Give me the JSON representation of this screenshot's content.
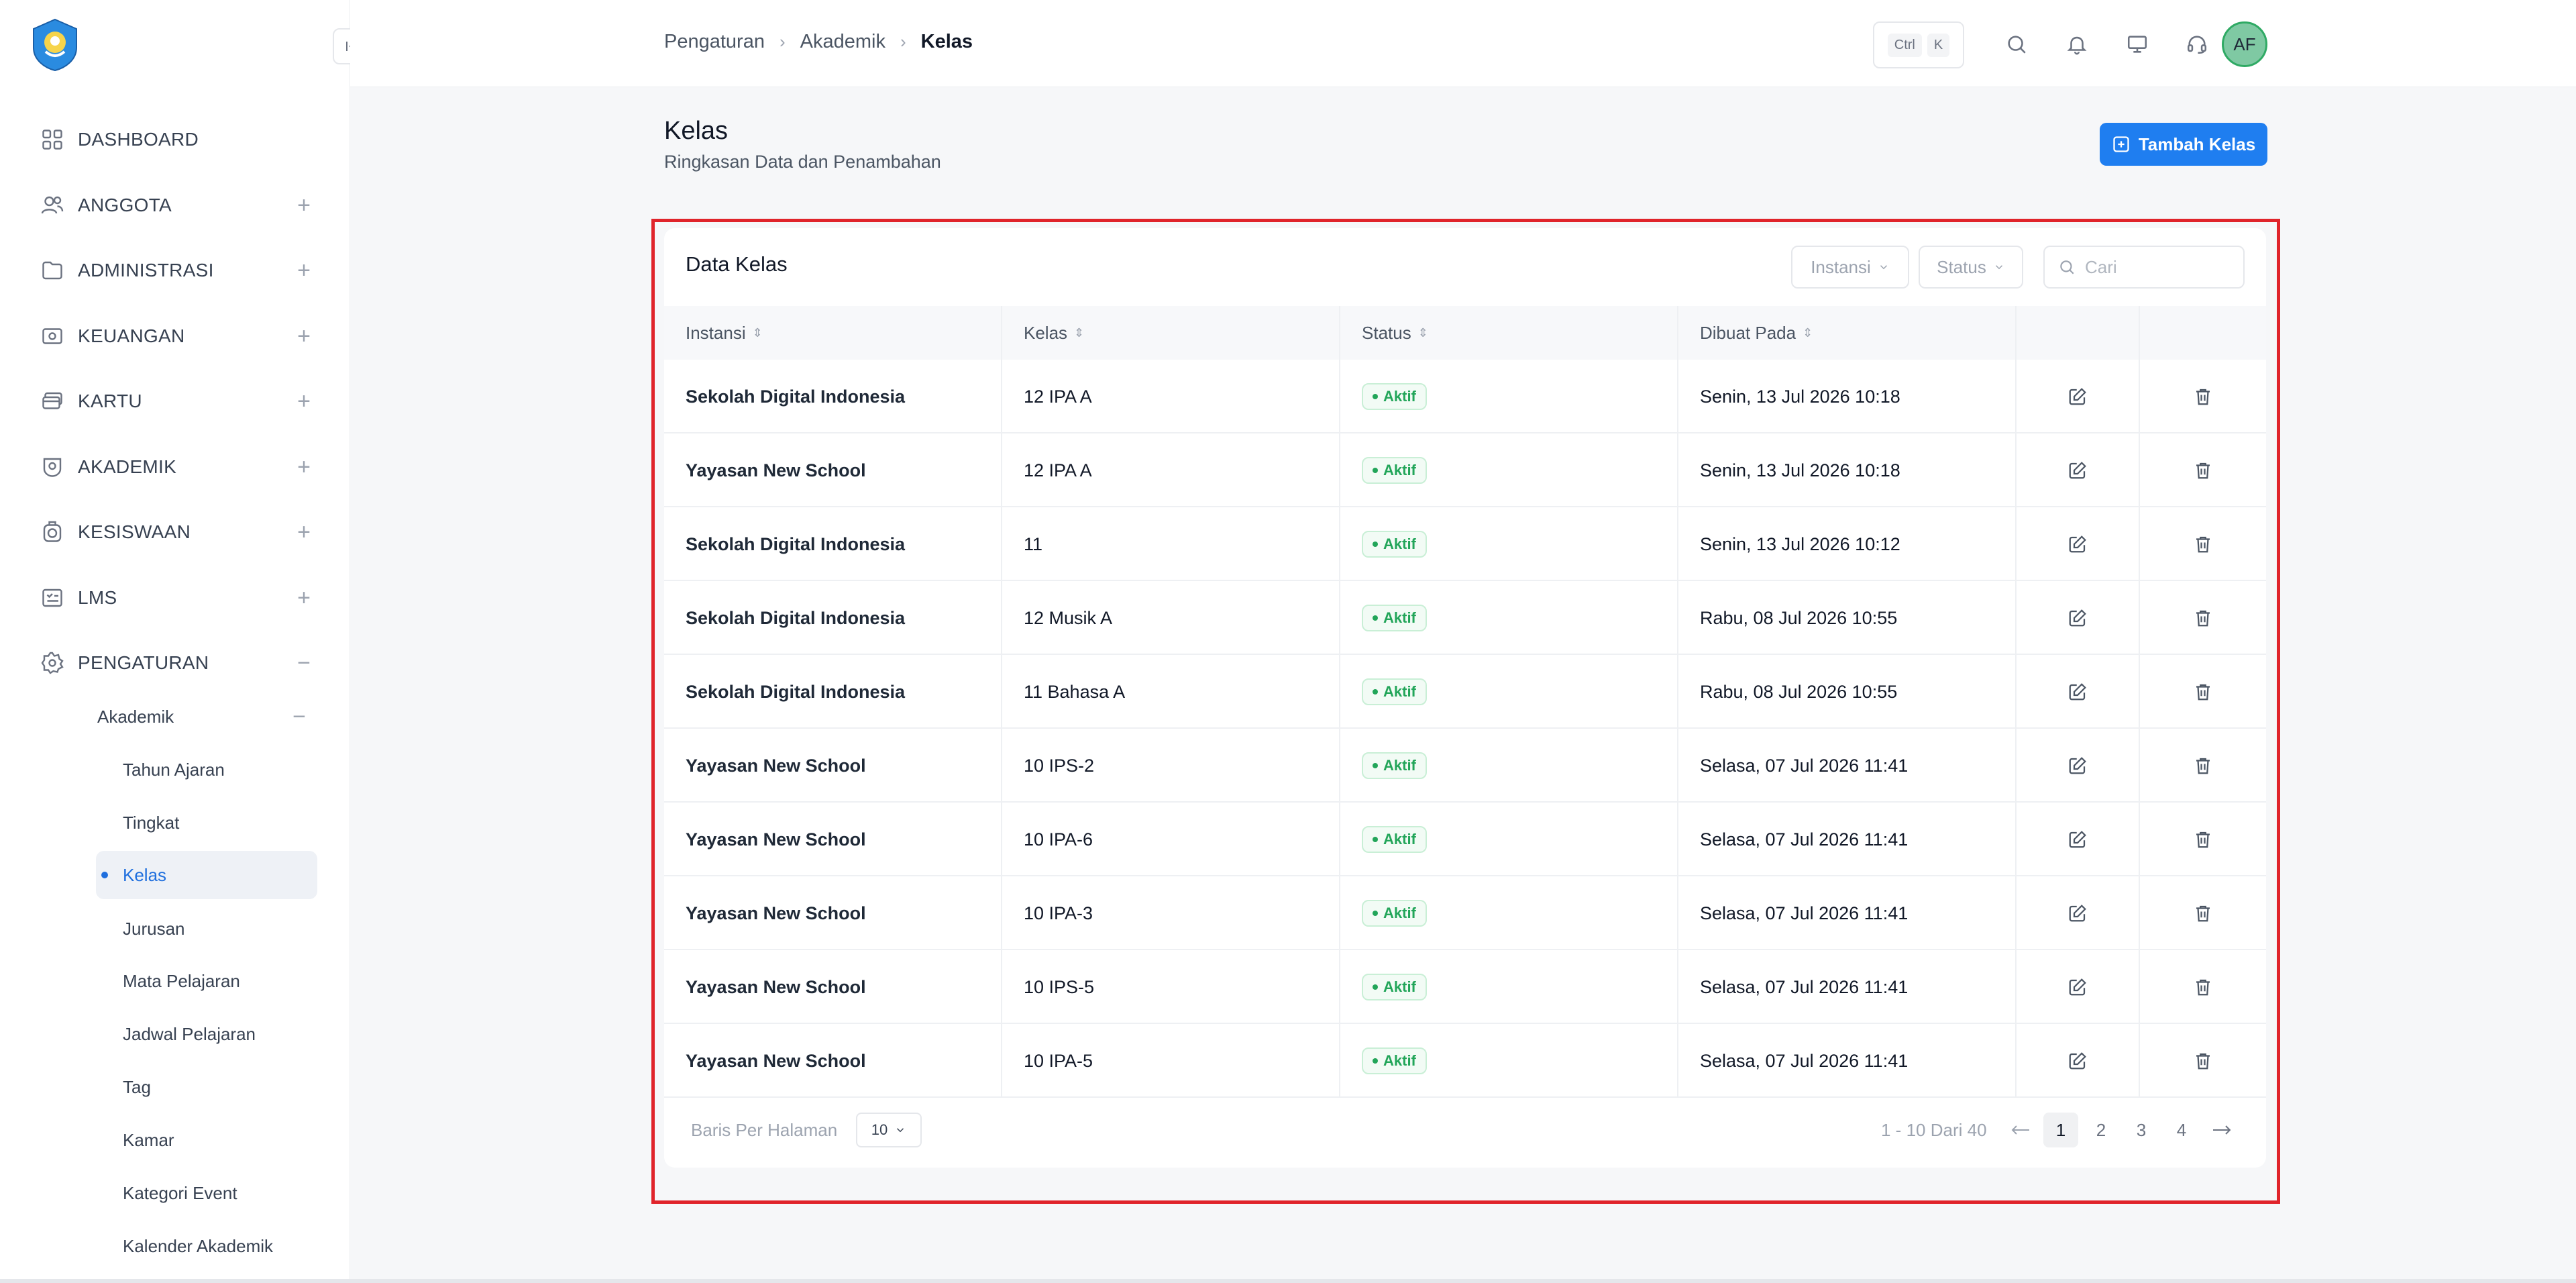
{
  "sidebar": {
    "items": [
      {
        "label": "DASHBOARD",
        "icon": "dashboard-icon",
        "expand": ""
      },
      {
        "label": "ANGGOTA",
        "icon": "users-icon",
        "expand": "+"
      },
      {
        "label": "ADMINISTRASI",
        "icon": "folder-icon",
        "expand": "+"
      },
      {
        "label": "KEUANGAN",
        "icon": "wallet-icon",
        "expand": "+"
      },
      {
        "label": "KARTU",
        "icon": "card-icon",
        "expand": "+"
      },
      {
        "label": "AKADEMIK",
        "icon": "academic-icon",
        "expand": "+"
      },
      {
        "label": "KESISWAAN",
        "icon": "student-icon",
        "expand": "+"
      },
      {
        "label": "LMS",
        "icon": "lms-icon",
        "expand": "+"
      },
      {
        "label": "PENGATURAN",
        "icon": "gear-icon",
        "expand": "−"
      }
    ],
    "sub": {
      "label": "Akademik",
      "expand": "−"
    },
    "subsub": [
      "Tahun Ajaran",
      "Tingkat",
      "Kelas",
      "Jurusan",
      "Mata Pelajaran",
      "Jadwal Pelajaran",
      "Tag",
      "Kamar",
      "Kategori Event",
      "Kalender Akademik"
    ],
    "active": "Kelas"
  },
  "topbar": {
    "breadcrumb": [
      "Pengaturan",
      "Akademik",
      "Kelas"
    ],
    "kbd": [
      "Ctrl",
      "K"
    ],
    "avatar": "AF"
  },
  "header": {
    "title": "Kelas",
    "subtitle": "Ringkasan Data dan Penambahan",
    "add_label": "Tambah Kelas"
  },
  "card": {
    "title": "Data Kelas",
    "filters": [
      "Instansi",
      "Status"
    ],
    "search_placeholder": "Cari",
    "columns": [
      "Instansi",
      "Kelas",
      "Status",
      "Dibuat Pada"
    ],
    "rows": [
      {
        "instansi": "Sekolah Digital Indonesia",
        "kelas": "12 IPA A",
        "status": "Aktif",
        "dibuat": "Senin, 13 Jul 2026 10:18"
      },
      {
        "instansi": "Yayasan New School",
        "kelas": "12 IPA A",
        "status": "Aktif",
        "dibuat": "Senin, 13 Jul 2026 10:18"
      },
      {
        "instansi": "Sekolah Digital Indonesia",
        "kelas": "11",
        "status": "Aktif",
        "dibuat": "Senin, 13 Jul 2026 10:12"
      },
      {
        "instansi": "Sekolah Digital Indonesia",
        "kelas": "12 Musik A",
        "status": "Aktif",
        "dibuat": "Rabu, 08 Jul 2026 10:55"
      },
      {
        "instansi": "Sekolah Digital Indonesia",
        "kelas": "11 Bahasa A",
        "status": "Aktif",
        "dibuat": "Rabu, 08 Jul 2026 10:55"
      },
      {
        "instansi": "Yayasan New School",
        "kelas": "10 IPS-2",
        "status": "Aktif",
        "dibuat": "Selasa, 07 Jul 2026 11:41"
      },
      {
        "instansi": "Yayasan New School",
        "kelas": "10 IPA-6",
        "status": "Aktif",
        "dibuat": "Selasa, 07 Jul 2026 11:41"
      },
      {
        "instansi": "Yayasan New School",
        "kelas": "10 IPA-3",
        "status": "Aktif",
        "dibuat": "Selasa, 07 Jul 2026 11:41"
      },
      {
        "instansi": "Yayasan New School",
        "kelas": "10 IPS-5",
        "status": "Aktif",
        "dibuat": "Selasa, 07 Jul 2026 11:41"
      },
      {
        "instansi": "Yayasan New School",
        "kelas": "10 IPA-5",
        "status": "Aktif",
        "dibuat": "Selasa, 07 Jul 2026 11:41"
      }
    ],
    "footer": {
      "rows_label": "Baris Per Halaman",
      "per_page": "10",
      "range": "1 - 10 Dari 40",
      "pages": [
        "1",
        "2",
        "3",
        "4"
      ],
      "current_page": "1"
    }
  },
  "colors": {
    "accent": "#1f7ef0",
    "status_active": "#22a559",
    "highlight": "#e0242b"
  }
}
